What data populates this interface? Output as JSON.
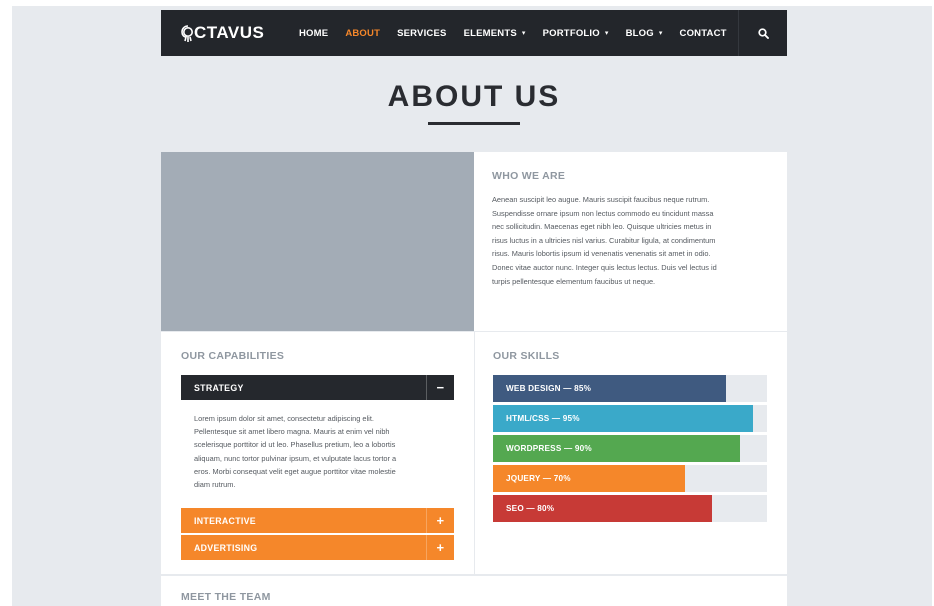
{
  "nav": {
    "logo": "CTAVUS",
    "items": [
      {
        "label": "HOME",
        "dropdown": false,
        "active": false
      },
      {
        "label": "ABOUT",
        "dropdown": false,
        "active": true
      },
      {
        "label": "SERVICES",
        "dropdown": false,
        "active": false
      },
      {
        "label": "ELEMENTS",
        "dropdown": true,
        "active": false
      },
      {
        "label": "PORTFOLIO",
        "dropdown": true,
        "active": false
      },
      {
        "label": "BLOG",
        "dropdown": true,
        "active": false
      },
      {
        "label": "CONTACT",
        "dropdown": false,
        "active": false
      }
    ],
    "search_icon": "search-icon",
    "active_color": "#f5872a"
  },
  "page": {
    "title": "ABOUT US"
  },
  "who": {
    "heading": "WHO WE ARE",
    "lines": [
      "Aenean suscipit leo augue. Mauris suscipit faucibus neque rutrum.",
      "Suspendisse ornare ipsum non lectus commodo eu tincidunt massa",
      "nec sollicitudin. Maecenas eget nibh leo. Quisque ultricies metus in",
      "risus luctus in a ultricies nisl varius. Curabitur ligula, at condimentum",
      "risus. Mauris lobortis ipsum id venenatis venenatis sit amet in odio.",
      "Donec vitae auctor nunc. Integer quis lectus lectus. Duis vel lectus id",
      "turpis pellentesque elementum faucibus ut neque."
    ]
  },
  "capabilities": {
    "heading": "OUR CAPABILITIES",
    "items": [
      {
        "label": "STRATEGY",
        "expanded": true,
        "toggle": "−",
        "color": "#25282d"
      },
      {
        "label": "INTERACTIVE",
        "expanded": false,
        "toggle": "+",
        "color": "#f5872a"
      },
      {
        "label": "ADVERTISING",
        "expanded": false,
        "toggle": "+",
        "color": "#f5872a"
      }
    ],
    "strategy_lines": [
      "Lorem ipsum dolor sit amet, consectetur adipiscing elit.",
      "Pellentesque sit amet libero magna. Mauris at enim vel nibh",
      "scelerisque porttitor id ut leo. Phasellus pretium, leo a lobortis",
      "aliquam, nunc tortor pulvinar ipsum, et vulputate lacus tortor a",
      "eros. Morbi consequat velit eget augue porttitor vitae molestie",
      "diam rutrum."
    ]
  },
  "skills": {
    "heading": "OUR SKILLS",
    "items": [
      {
        "label": "WEB DESIGN — 85%",
        "percent": 85,
        "color": "#3f5a80"
      },
      {
        "label": "HTML/CSS — 95%",
        "percent": 95,
        "color": "#3aa9c9"
      },
      {
        "label": "WORDPRESS — 90%",
        "percent": 90,
        "color": "#54a850"
      },
      {
        "label": "JQUERY — 70%",
        "percent": 70,
        "color": "#f5872a"
      },
      {
        "label": "SEO — 80%",
        "percent": 80,
        "color": "#c73a36"
      }
    ]
  },
  "team": {
    "heading": "MEET THE TEAM"
  }
}
